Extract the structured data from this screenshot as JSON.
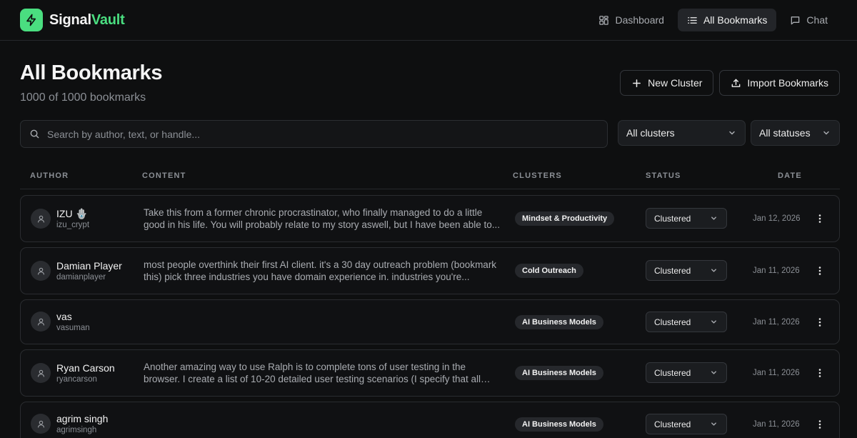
{
  "app": {
    "name_part1": "Signal",
    "name_part2": "Vault",
    "accent": "#4ade80"
  },
  "nav": {
    "items": [
      {
        "label": "Dashboard",
        "icon": "dashboard-icon",
        "active": false
      },
      {
        "label": "All Bookmarks",
        "icon": "list-icon",
        "active": true
      },
      {
        "label": "Chat",
        "icon": "chat-icon",
        "active": false
      }
    ]
  },
  "header": {
    "title": "All Bookmarks",
    "subtitle": "1000 of 1000 bookmarks",
    "new_cluster_label": "New Cluster",
    "import_label": "Import Bookmarks"
  },
  "filters": {
    "search_placeholder": "Search by author, text, or handle...",
    "cluster_value": "All clusters",
    "status_value": "All statuses"
  },
  "table": {
    "columns": [
      "AUTHOR",
      "CONTENT",
      "CLUSTERS",
      "STATUS",
      "DATE"
    ],
    "rows": [
      {
        "name": "IZU 🪬",
        "handle": "izu_crypt",
        "content": "Take this from a former chronic procrastinator, who finally managed to do a little good in his life. You will probably relate to my story aswell, but I have been able to...",
        "cluster": "Mindset & Productivity",
        "status": "Clustered",
        "date": "Jan 12, 2026"
      },
      {
        "name": "Damian Player",
        "handle": "damianplayer",
        "content": "most people overthink their first AI client. it's a 30 day outreach problem (bookmark this) pick three industries you have domain experience in. industries you're...",
        "cluster": "Cold Outreach",
        "status": "Clustered",
        "date": "Jan 11, 2026"
      },
      {
        "name": "vas",
        "handle": "vasuman",
        "content": "",
        "cluster": "AI Business Models",
        "status": "Clustered",
        "date": "Jan 11, 2026"
      },
      {
        "name": "Ryan Carson",
        "handle": "ryancarson",
        "content": "Another amazing way to use Ralph is to complete tons of user testing in the browser. I create a list of 10-20 detailed user testing scenarios (I specify that all acceptance...",
        "cluster": "AI Business Models",
        "status": "Clustered",
        "date": "Jan 11, 2026"
      },
      {
        "name": "agrim singh",
        "handle": "agrimsingh",
        "content": "",
        "cluster": "AI Business Models",
        "status": "Clustered",
        "date": "Jan 11, 2026"
      }
    ]
  }
}
